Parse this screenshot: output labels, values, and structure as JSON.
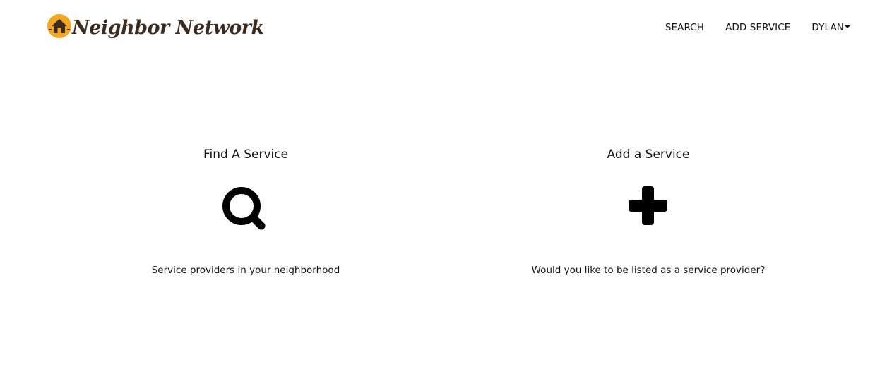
{
  "brand": {
    "name": "Neighbor Network",
    "logo_icon": "house-icon",
    "logo_color": "#f5a623",
    "text_color": "#3b2b1f"
  },
  "nav": {
    "search_label": "SEARCH",
    "add_service_label": "ADD SERVICE",
    "user_label": "DYLAN",
    "user_dropdown_icon": "caret-down-icon"
  },
  "panels": {
    "find": {
      "title": "Find A Service",
      "icon": "search-icon",
      "description": "Service providers in your neighborhood"
    },
    "add": {
      "title": "Add a Service",
      "icon": "plus-icon",
      "description": "Would you like to be listed as a service provider?"
    }
  }
}
